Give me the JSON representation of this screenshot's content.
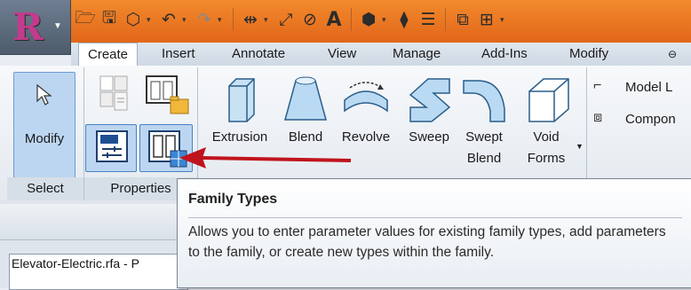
{
  "app": {
    "logo_letter": "R"
  },
  "tabs": [
    "Create",
    "Insert",
    "Annotate",
    "View",
    "Manage",
    "Add-Ins",
    "Modify"
  ],
  "active_tab": "Create",
  "ribbon": {
    "modify_label": "Modify",
    "select_panel": "Select",
    "properties_panel": "Properties",
    "tools": [
      {
        "label1": "Extrusion",
        "label2": ""
      },
      {
        "label1": "Blend",
        "label2": ""
      },
      {
        "label1": "Revolve",
        "label2": ""
      },
      {
        "label1": "Sweep",
        "label2": ""
      },
      {
        "label1": "Swept",
        "label2": "Blend"
      },
      {
        "label1": "Void",
        "label2": "Forms"
      }
    ],
    "model_line": "Model L",
    "component": "Compon"
  },
  "tooltip": {
    "title": "Family Types",
    "body": "Allows you to enter parameter values for existing family types, add parameters to the family, or create new types within the family."
  },
  "browser": {
    "title": "Elevator-Electric.rfa - P"
  },
  "colors": {
    "accent_orange": "#e97323",
    "arrow_red": "#c0141c",
    "selected_blue": "#bcd6f1"
  }
}
